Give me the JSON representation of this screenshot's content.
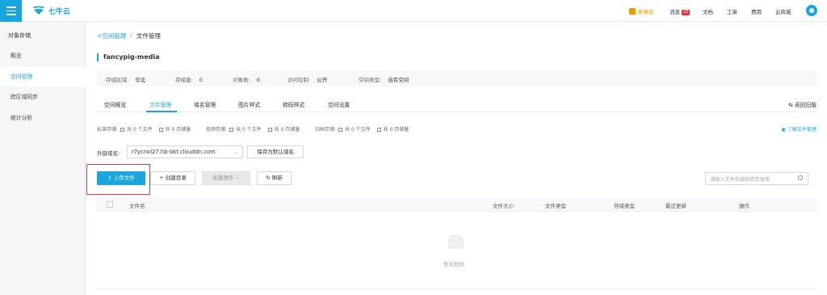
{
  "brand": {
    "name": "七牛云",
    "accent": "#18a5e0"
  },
  "topnav": {
    "promo": "新惠管",
    "messages": "消息",
    "messages_count": "22",
    "docs": "文档",
    "tickets": "工单",
    "billing": "费用",
    "market": "云商城"
  },
  "sidebar": {
    "title": "对象存储",
    "items": [
      {
        "label": "概览"
      },
      {
        "label": "空间管理"
      },
      {
        "label": "跨区域同步"
      },
      {
        "label": "统计分析"
      }
    ]
  },
  "breadcrumb": {
    "back": "空间管理",
    "separator": "/",
    "current": "文件管理"
  },
  "bucket": {
    "name": "fancypig-media",
    "region_label": "存储区域:",
    "region": "华北",
    "storage_label": "存储量:",
    "storage": "0",
    "objects_label": "对象数:",
    "objects": "0",
    "access_label": "访问控制:",
    "access": "公开",
    "type_label": "空间类型:",
    "type": "自有空间"
  },
  "tabs": [
    {
      "label": "空间概览"
    },
    {
      "label": "文件管理"
    },
    {
      "label": "域名管理"
    },
    {
      "label": "图片样式"
    },
    {
      "label": "转码样式"
    },
    {
      "label": "空间设置"
    }
  ],
  "back_old": "返回旧版",
  "stats": {
    "standard_label": "标准存储:",
    "standard_files": "共 0 个文件",
    "standard_storage": "共 0 存储量",
    "low_label": "低频存储:",
    "low_files": "共 0 个文件",
    "low_storage": "共 0 存储量",
    "archive_label": "归档存储:",
    "archive_files": "共 0 个文件",
    "archive_storage": "共 0 存储量"
  },
  "learn_link": "了解文件管理",
  "domain": {
    "label": "外链域名:",
    "value": "r7ycnxl27.hb-bkt.clouddn.com",
    "save_default": "保存为默认域名"
  },
  "toolbar": {
    "upload": "上传文件",
    "create_dir": "创建目录",
    "batch": "批量操作",
    "refresh": "刷新",
    "search_placeholder": "请输入文件前缀按回车搜索"
  },
  "table": {
    "columns": [
      "文件名",
      "文件大小",
      "文件类型",
      "存储类型",
      "最近更新",
      "操作"
    ],
    "empty_text": "暂无数据"
  }
}
